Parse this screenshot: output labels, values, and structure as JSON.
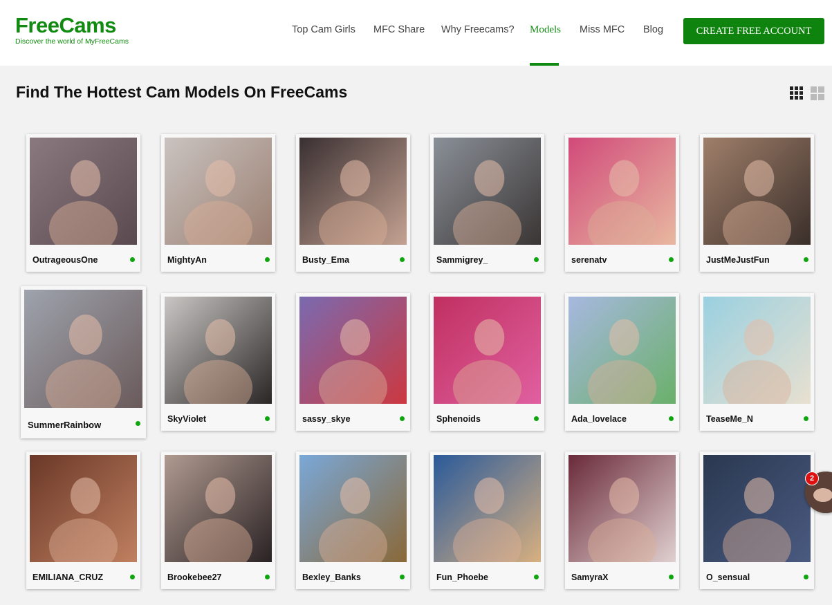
{
  "brand": {
    "name": "FreeCams",
    "tagline": "Discover the world of MyFreeCams"
  },
  "nav": {
    "items": [
      {
        "label": "Top Cam Girls",
        "active": false
      },
      {
        "label": "MFC Share",
        "active": false
      },
      {
        "label": "Why Freecams?",
        "active": false
      },
      {
        "label": "Models",
        "active": true
      },
      {
        "label": "Miss MFC",
        "active": false
      },
      {
        "label": "Blog",
        "active": false
      }
    ],
    "cta": "CREATE FREE ACCOUNT"
  },
  "page": {
    "title": "Find The Hottest Cam Models On FreeCams"
  },
  "view_toggle": {
    "options": [
      "grid-small-icon",
      "grid-large-icon"
    ],
    "selected": "grid-small-icon"
  },
  "models": [
    {
      "name": "OutrageousOne",
      "online": true,
      "thumb_colors": [
        "#8a7a80",
        "#5a4a4f"
      ]
    },
    {
      "name": "MightyAn",
      "online": true,
      "thumb_colors": [
        "#c9c3c0",
        "#9a7e70"
      ]
    },
    {
      "name": "Busty_Ema",
      "online": true,
      "thumb_colors": [
        "#3a3032",
        "#c4a292"
      ]
    },
    {
      "name": "Sammigrey_",
      "online": true,
      "thumb_colors": [
        "#8a9098",
        "#3a3534"
      ]
    },
    {
      "name": "serenatv",
      "online": true,
      "thumb_colors": [
        "#d14a7a",
        "#e8b8a0"
      ]
    },
    {
      "name": "JustMeJustFun",
      "online": true,
      "thumb_colors": [
        "#a07f6a",
        "#3a2f2a"
      ]
    },
    {
      "name": "SummerRainbow",
      "online": true,
      "thumb_colors": [
        "#9ea3ad",
        "#6a5a5a"
      ]
    },
    {
      "name": "SkyViolet",
      "online": true,
      "thumb_colors": [
        "#c9c7c4",
        "#2a2626"
      ]
    },
    {
      "name": "sassy_skye",
      "online": true,
      "thumb_colors": [
        "#7a6ab0",
        "#cc3840"
      ]
    },
    {
      "name": "Sphenoids",
      "online": true,
      "thumb_colors": [
        "#c03060",
        "#e060a0"
      ]
    },
    {
      "name": "Ada_lovelace",
      "online": true,
      "thumb_colors": [
        "#a7b8e0",
        "#6ab06a"
      ]
    },
    {
      "name": "TeaseMe_N",
      "online": true,
      "thumb_colors": [
        "#9ad0e0",
        "#e8e0d0"
      ]
    },
    {
      "name": "EMILIANA_CRUZ",
      "online": true,
      "thumb_colors": [
        "#6a3828",
        "#c08060"
      ]
    },
    {
      "name": "Brookebee27",
      "online": true,
      "thumb_colors": [
        "#b09a90",
        "#2a2224"
      ]
    },
    {
      "name": "Bexley_Banks",
      "online": true,
      "thumb_colors": [
        "#7aa8d8",
        "#8a6838"
      ]
    },
    {
      "name": "Fun_Phoebe",
      "online": true,
      "thumb_colors": [
        "#2a5a9a",
        "#d8b080"
      ]
    },
    {
      "name": "SamyraX",
      "online": true,
      "thumb_colors": [
        "#6a2a3a",
        "#e0d0d0"
      ]
    },
    {
      "name": "O_sensual",
      "online": true,
      "thumb_colors": [
        "#2a3850",
        "#4a5a80"
      ]
    }
  ],
  "chat": {
    "badge": "2"
  }
}
